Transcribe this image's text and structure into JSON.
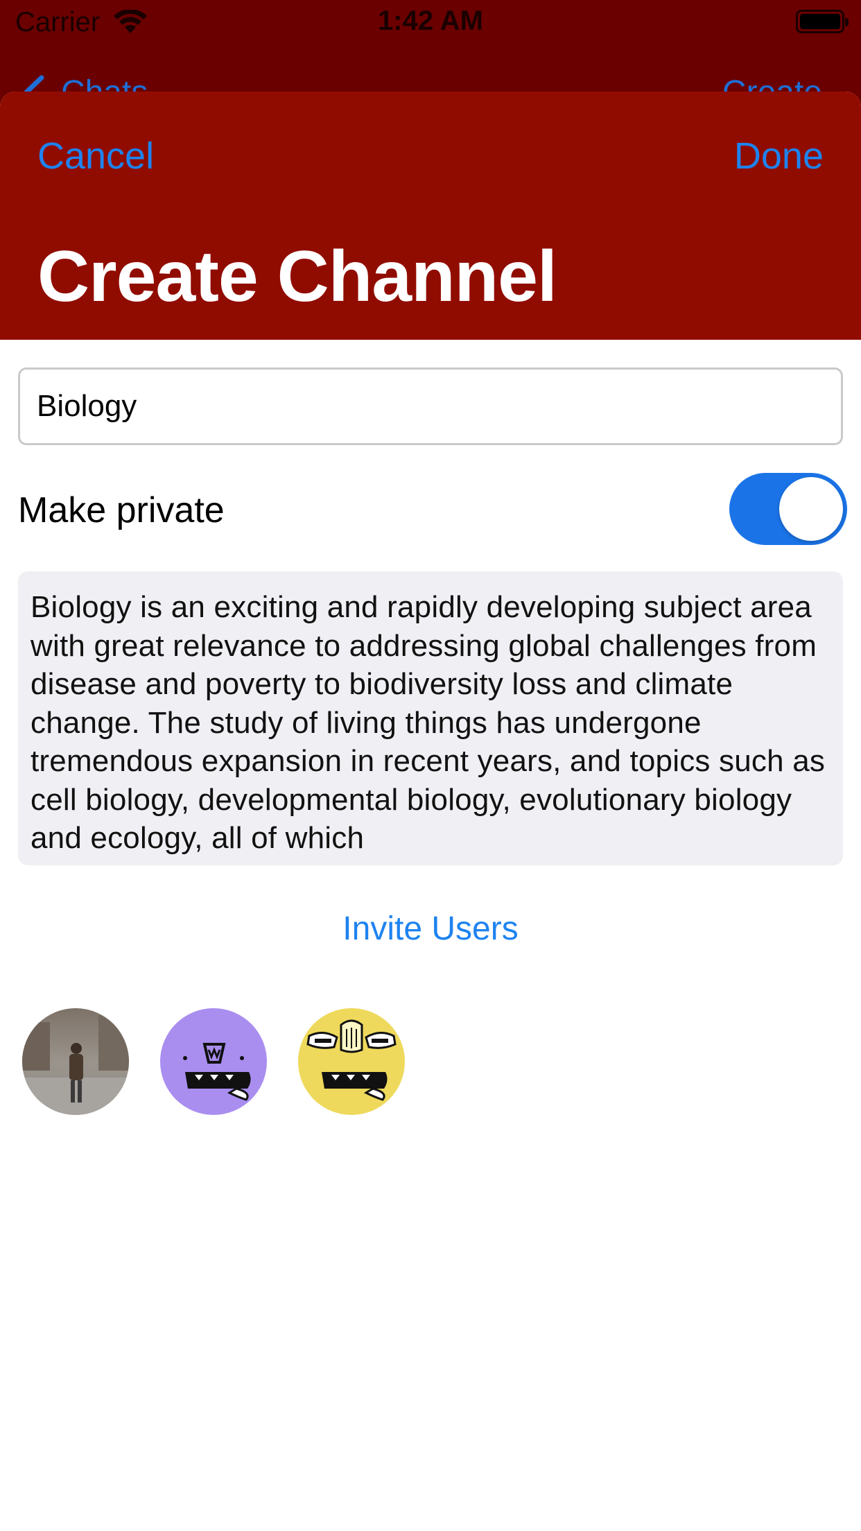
{
  "status_bar": {
    "carrier": "Carrier",
    "time": "1:42 AM"
  },
  "underlying_nav": {
    "back_label": "Chats",
    "right_label": "Create"
  },
  "sheet": {
    "cancel_label": "Cancel",
    "done_label": "Done",
    "title": "Create Channel",
    "channel_name": "Biology",
    "private_label": "Make private",
    "private_on": true,
    "description": "Biology is an exciting and rapidly developing subject area with great relevance to addressing global challenges from disease and poverty to biodiversity loss and climate change. The study of living things has undergone tremendous expansion in recent years, and topics such as cell biology, developmental biology, evolutionary biology and ecology, all of which",
    "invite_label": "Invite Users"
  },
  "invited_users": [
    {
      "avatar": "photo-person-icon",
      "color": "#8a8580"
    },
    {
      "avatar": "purple-monster-icon",
      "color": "#a98ef0"
    },
    {
      "avatar": "yellow-monster-icon",
      "color": "#eed95c"
    }
  ],
  "colors": {
    "header_red": "#910c00",
    "status_red": "#6a0000",
    "accent_blue": "#1e83f0",
    "toggle_blue": "#1a74e8"
  }
}
